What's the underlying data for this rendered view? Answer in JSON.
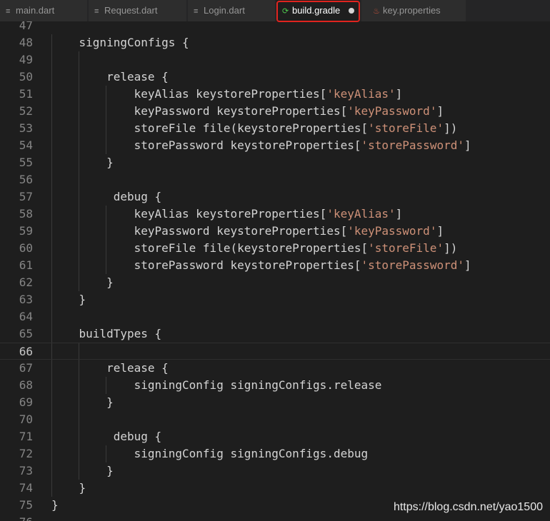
{
  "tabs": [
    {
      "label": "main.dart",
      "icon": "≡"
    },
    {
      "label": "Request.dart",
      "icon": "≡"
    },
    {
      "label": "Login.dart",
      "icon": "≡"
    },
    {
      "label": "build.gradle",
      "icon": "⟳",
      "active": true,
      "dirty": true
    },
    {
      "label": "key.properties",
      "icon": "♨"
    }
  ],
  "editor": {
    "current_line": "66",
    "lines": [
      {
        "n": "47",
        "parts": [
          {
            "t": ""
          }
        ]
      },
      {
        "n": "48",
        "parts": [
          {
            "t": "    signingConfigs {"
          }
        ]
      },
      {
        "n": "49",
        "parts": [
          {
            "t": ""
          }
        ]
      },
      {
        "n": "50",
        "parts": [
          {
            "t": "        release {"
          }
        ]
      },
      {
        "n": "51",
        "parts": [
          {
            "t": "            keyAlias keystoreProperties["
          },
          {
            "t": "'keyAlias'",
            "s": true
          },
          {
            "t": "]"
          }
        ]
      },
      {
        "n": "52",
        "parts": [
          {
            "t": "            keyPassword keystoreProperties["
          },
          {
            "t": "'keyPassword'",
            "s": true
          },
          {
            "t": "]"
          }
        ]
      },
      {
        "n": "53",
        "parts": [
          {
            "t": "            storeFile file(keystoreProperties["
          },
          {
            "t": "'storeFile'",
            "s": true
          },
          {
            "t": "])"
          }
        ]
      },
      {
        "n": "54",
        "parts": [
          {
            "t": "            storePassword keystoreProperties["
          },
          {
            "t": "'storePassword'",
            "s": true
          },
          {
            "t": "]"
          }
        ]
      },
      {
        "n": "55",
        "parts": [
          {
            "t": "        }"
          }
        ]
      },
      {
        "n": "56",
        "parts": [
          {
            "t": ""
          }
        ]
      },
      {
        "n": "57",
        "parts": [
          {
            "t": "         debug {"
          }
        ]
      },
      {
        "n": "58",
        "parts": [
          {
            "t": "            keyAlias keystoreProperties["
          },
          {
            "t": "'keyAlias'",
            "s": true
          },
          {
            "t": "]"
          }
        ]
      },
      {
        "n": "59",
        "parts": [
          {
            "t": "            keyPassword keystoreProperties["
          },
          {
            "t": "'keyPassword'",
            "s": true
          },
          {
            "t": "]"
          }
        ]
      },
      {
        "n": "60",
        "parts": [
          {
            "t": "            storeFile file(keystoreProperties["
          },
          {
            "t": "'storeFile'",
            "s": true
          },
          {
            "t": "])"
          }
        ]
      },
      {
        "n": "61",
        "parts": [
          {
            "t": "            storePassword keystoreProperties["
          },
          {
            "t": "'storePassword'",
            "s": true
          },
          {
            "t": "]"
          }
        ]
      },
      {
        "n": "62",
        "parts": [
          {
            "t": "        }"
          }
        ]
      },
      {
        "n": "63",
        "parts": [
          {
            "t": "    }"
          }
        ]
      },
      {
        "n": "64",
        "parts": [
          {
            "t": ""
          }
        ]
      },
      {
        "n": "65",
        "parts": [
          {
            "t": "    buildTypes {"
          }
        ]
      },
      {
        "n": "66",
        "parts": [
          {
            "t": ""
          }
        ]
      },
      {
        "n": "67",
        "parts": [
          {
            "t": "        release {"
          }
        ]
      },
      {
        "n": "68",
        "parts": [
          {
            "t": "            signingConfig signingConfigs.release"
          }
        ]
      },
      {
        "n": "69",
        "parts": [
          {
            "t": "        }"
          }
        ]
      },
      {
        "n": "70",
        "parts": [
          {
            "t": ""
          }
        ]
      },
      {
        "n": "71",
        "parts": [
          {
            "t": "         debug {"
          }
        ]
      },
      {
        "n": "72",
        "parts": [
          {
            "t": "            signingConfig signingConfigs.debug"
          }
        ]
      },
      {
        "n": "73",
        "parts": [
          {
            "t": "        }"
          }
        ]
      },
      {
        "n": "74",
        "parts": [
          {
            "t": "    }"
          }
        ]
      },
      {
        "n": "75",
        "parts": [
          {
            "t": "}"
          }
        ]
      },
      {
        "n": "76",
        "parts": [
          {
            "t": ""
          }
        ]
      }
    ]
  },
  "watermark": "https://blog.csdn.net/yao1500",
  "colors": {
    "string": "#ce9178",
    "text": "#d4d4d4",
    "background": "#1e1e1e",
    "highlight_box": "#e0241f"
  }
}
